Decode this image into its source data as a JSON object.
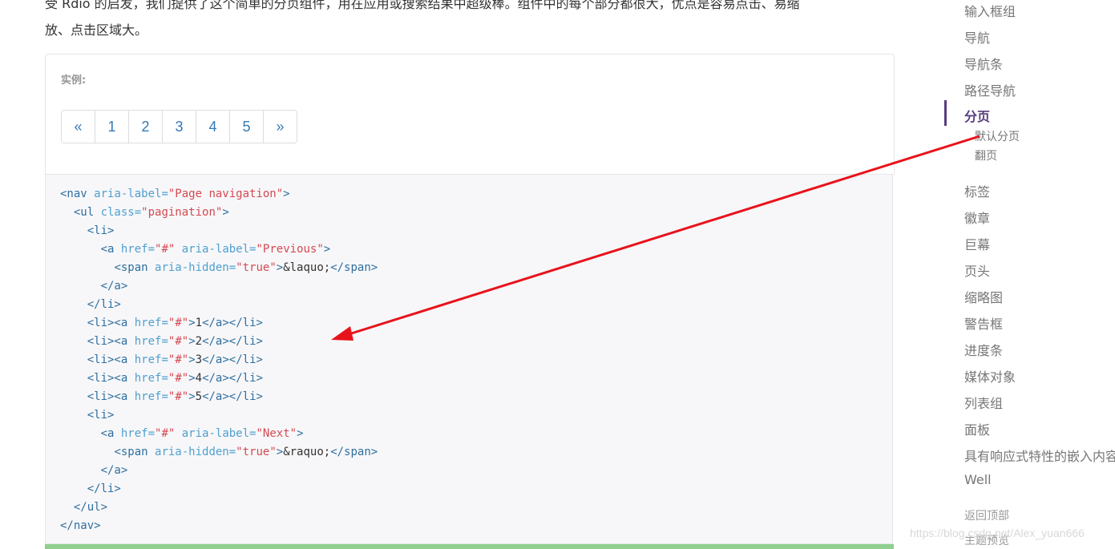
{
  "intro": {
    "line1": "受 Rdio 的启发，我们提供了这个简单的分页组件，用在应用或搜索结果中超级棒。组件中的每个部分都很大，优点是容易点击、易缩",
    "line2": "放、点击区域大。"
  },
  "example": {
    "label": "实例:",
    "pagination": [
      "«",
      "1",
      "2",
      "3",
      "4",
      "5",
      "»"
    ]
  },
  "code": {
    "lines": [
      [
        {
          "t": "tag",
          "v": "<nav "
        },
        {
          "t": "attr",
          "v": "aria-label="
        },
        {
          "t": "val",
          "v": "\"Page navigation\""
        },
        {
          "t": "tag",
          "v": ">"
        }
      ],
      [
        {
          "t": "txt",
          "v": "  "
        },
        {
          "t": "tag",
          "v": "<ul "
        },
        {
          "t": "attr",
          "v": "class="
        },
        {
          "t": "val",
          "v": "\"pagination\""
        },
        {
          "t": "tag",
          "v": ">"
        }
      ],
      [
        {
          "t": "txt",
          "v": "    "
        },
        {
          "t": "tag",
          "v": "<li>"
        }
      ],
      [
        {
          "t": "txt",
          "v": "      "
        },
        {
          "t": "tag",
          "v": "<a "
        },
        {
          "t": "attr",
          "v": "href="
        },
        {
          "t": "val",
          "v": "\"#\""
        },
        {
          "t": "attr",
          "v": " aria-label="
        },
        {
          "t": "val",
          "v": "\"Previous\""
        },
        {
          "t": "tag",
          "v": ">"
        }
      ],
      [
        {
          "t": "txt",
          "v": "        "
        },
        {
          "t": "tag",
          "v": "<span "
        },
        {
          "t": "attr",
          "v": "aria-hidden="
        },
        {
          "t": "val",
          "v": "\"true\""
        },
        {
          "t": "tag",
          "v": ">"
        },
        {
          "t": "txt",
          "v": "&laquo;"
        },
        {
          "t": "tag",
          "v": "</span>"
        }
      ],
      [
        {
          "t": "txt",
          "v": "      "
        },
        {
          "t": "tag",
          "v": "</a>"
        }
      ],
      [
        {
          "t": "txt",
          "v": "    "
        },
        {
          "t": "tag",
          "v": "</li>"
        }
      ],
      [
        {
          "t": "txt",
          "v": "    "
        },
        {
          "t": "tag",
          "v": "<li><a "
        },
        {
          "t": "attr",
          "v": "href="
        },
        {
          "t": "val",
          "v": "\"#\""
        },
        {
          "t": "tag",
          "v": ">"
        },
        {
          "t": "txt",
          "v": "1"
        },
        {
          "t": "tag",
          "v": "</a></li>"
        }
      ],
      [
        {
          "t": "txt",
          "v": "    "
        },
        {
          "t": "tag",
          "v": "<li><a "
        },
        {
          "t": "attr",
          "v": "href="
        },
        {
          "t": "val",
          "v": "\"#\""
        },
        {
          "t": "tag",
          "v": ">"
        },
        {
          "t": "txt",
          "v": "2"
        },
        {
          "t": "tag",
          "v": "</a></li>"
        }
      ],
      [
        {
          "t": "txt",
          "v": "    "
        },
        {
          "t": "tag",
          "v": "<li><a "
        },
        {
          "t": "attr",
          "v": "href="
        },
        {
          "t": "val",
          "v": "\"#\""
        },
        {
          "t": "tag",
          "v": ">"
        },
        {
          "t": "txt",
          "v": "3"
        },
        {
          "t": "tag",
          "v": "</a></li>"
        }
      ],
      [
        {
          "t": "txt",
          "v": "    "
        },
        {
          "t": "tag",
          "v": "<li><a "
        },
        {
          "t": "attr",
          "v": "href="
        },
        {
          "t": "val",
          "v": "\"#\""
        },
        {
          "t": "tag",
          "v": ">"
        },
        {
          "t": "txt",
          "v": "4"
        },
        {
          "t": "tag",
          "v": "</a></li>"
        }
      ],
      [
        {
          "t": "txt",
          "v": "    "
        },
        {
          "t": "tag",
          "v": "<li><a "
        },
        {
          "t": "attr",
          "v": "href="
        },
        {
          "t": "val",
          "v": "\"#\""
        },
        {
          "t": "tag",
          "v": ">"
        },
        {
          "t": "txt",
          "v": "5"
        },
        {
          "t": "tag",
          "v": "</a></li>"
        }
      ],
      [
        {
          "t": "txt",
          "v": "    "
        },
        {
          "t": "tag",
          "v": "<li>"
        }
      ],
      [
        {
          "t": "txt",
          "v": "      "
        },
        {
          "t": "tag",
          "v": "<a "
        },
        {
          "t": "attr",
          "v": "href="
        },
        {
          "t": "val",
          "v": "\"#\""
        },
        {
          "t": "attr",
          "v": " aria-label="
        },
        {
          "t": "val",
          "v": "\"Next\""
        },
        {
          "t": "tag",
          "v": ">"
        }
      ],
      [
        {
          "t": "txt",
          "v": "        "
        },
        {
          "t": "tag",
          "v": "<span "
        },
        {
          "t": "attr",
          "v": "aria-hidden="
        },
        {
          "t": "val",
          "v": "\"true\""
        },
        {
          "t": "tag",
          "v": ">"
        },
        {
          "t": "txt",
          "v": "&raquo;"
        },
        {
          "t": "tag",
          "v": "</span>"
        }
      ],
      [
        {
          "t": "txt",
          "v": "      "
        },
        {
          "t": "tag",
          "v": "</a>"
        }
      ],
      [
        {
          "t": "txt",
          "v": "    "
        },
        {
          "t": "tag",
          "v": "</li>"
        }
      ],
      [
        {
          "t": "txt",
          "v": "  "
        },
        {
          "t": "tag",
          "v": "</ul>"
        }
      ],
      [
        {
          "t": "tag",
          "v": "</nav>"
        }
      ]
    ]
  },
  "sidebar": {
    "items": [
      "输入框组",
      "导航",
      "导航条",
      "路径导航",
      "分页"
    ],
    "active": "分页",
    "sub_items": [
      "默认分页",
      "翻页"
    ],
    "items_after": [
      "标签",
      "徽章",
      "巨幕",
      "页头",
      "缩略图",
      "警告框",
      "进度条",
      "媒体对象",
      "列表组",
      "面板",
      "具有响应式特性的嵌入内容",
      "Well"
    ],
    "footer": [
      "返回顶部",
      "主题预览"
    ]
  },
  "watermark": "https://blog.csdn.net/Alex_yuan666",
  "colors": {
    "accent": "#563d7c",
    "link": "#337ab7",
    "arrow": "#e8121b",
    "success_bar": "#90cf8e"
  }
}
